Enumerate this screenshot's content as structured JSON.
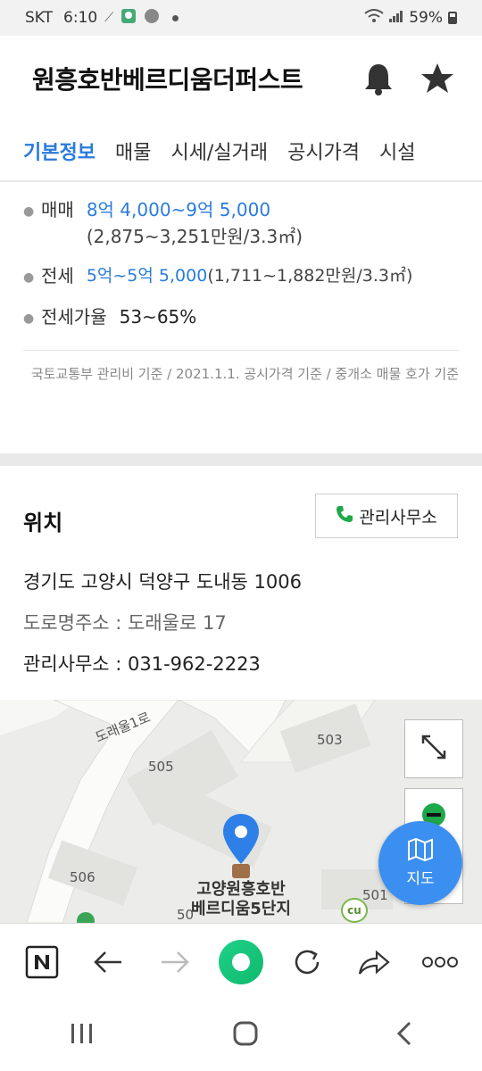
{
  "status": {
    "carrier": "SKT",
    "time": "6:10",
    "battery": "59%"
  },
  "header": {
    "title": "원흥호반베르디움더퍼스트"
  },
  "tabs": [
    "기본정보",
    "매물",
    "시세/실거래",
    "공시가격",
    "시설"
  ],
  "price": {
    "sale_label": "매매",
    "sale_value": "8억 4,000~9억 5,000",
    "sale_sub": "(2,875~3,251만원/3.3㎡)",
    "jeonse_label": "전세",
    "jeonse_value": "5억~5억 5,000",
    "jeonse_sub": "(1,711~1,882만원/3.3㎡)",
    "ratio_label": "전세가율",
    "ratio_value": "53~65%",
    "note": "국토교통부 관리비 기준 / 2021.1.1. 공시가격 기준 / 중개소 매물 호가 기준"
  },
  "location": {
    "title": "위치",
    "office_button": "관리사무소",
    "address": "경기도 고양시 덕양구 도내동 1006",
    "road_address": "도로명주소 : 도래울로 17",
    "office_phone": "관리사무소 : 031-962-2223"
  },
  "map": {
    "road_label": "도래울1로",
    "buildings": [
      "503",
      "505",
      "506",
      "501",
      "50"
    ],
    "pin_label_line1": "고양원흥호반",
    "pin_label_line2": "베르디움5단지",
    "fab_label": "지도",
    "store_label": "cu"
  },
  "colors": {
    "accent": "#2a7bdc",
    "fab": "#3b8ff0",
    "pin": "#2f7fe8",
    "phone_green": "#1fa84a"
  }
}
